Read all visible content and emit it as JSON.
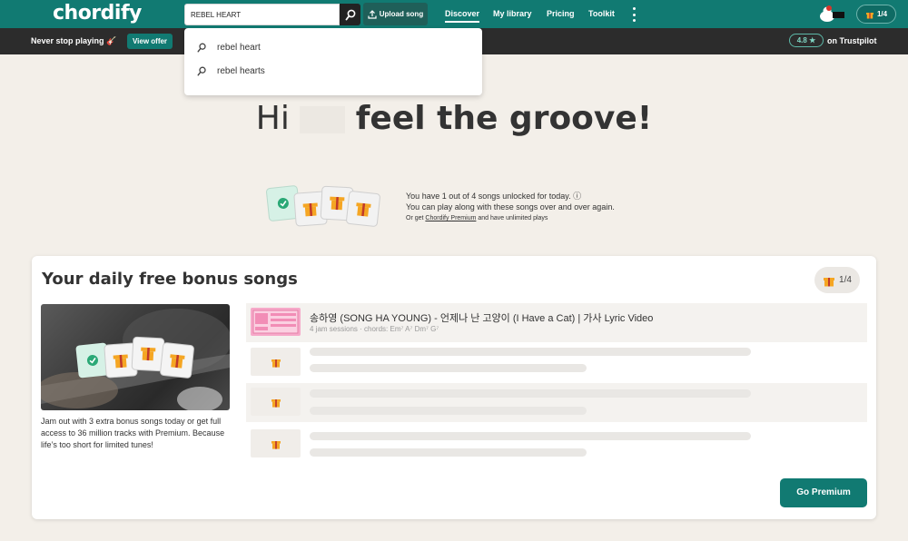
{
  "header": {
    "logo": "chordify",
    "search_value": "REBEL HEART",
    "upload_label": "Upload song",
    "nav": [
      "Discover",
      "My library",
      "Pricing",
      "Toolkit"
    ],
    "gift_count": "1/4"
  },
  "promo": {
    "text": "Never stop playing 🎸",
    "offer_label": "View offer",
    "rating": "4.8 ★",
    "trustpilot": "on Trustpilot"
  },
  "search_suggestions": [
    "rebel heart",
    "rebel hearts"
  ],
  "hero": {
    "greeting": "Hi",
    "tagline": "feel the groove!"
  },
  "unlock_info": {
    "line1": "You have 1 out of 4 songs unlocked for today. ⓘ",
    "line2": "You can play along with these songs over and over again.",
    "line3_pre": "Or get",
    "line3_link": "Chordify Premium",
    "line3_post": "and have unlimited plays"
  },
  "bonus": {
    "title": "Your daily free bonus songs",
    "count": "1/4",
    "description": "Jam out with 3 extra bonus songs today or get full access to 36 million tracks with Premium. Because life’s too short for limited tunes!",
    "songs": [
      {
        "title": "송하영 (SONG HA YOUNG) - 언제나 난 고양이 (I Have a Cat) | 가사 Lyric Video",
        "meta": "4 jam sessions · chords: Em⁷ A⁷ Dm⁷ G⁷"
      }
    ],
    "cta": "Go Premium"
  },
  "colors": {
    "brand": "#117a72",
    "promo_bar": "#2c2c2c",
    "background": "#f3efe9",
    "gift": "#f5a623"
  }
}
